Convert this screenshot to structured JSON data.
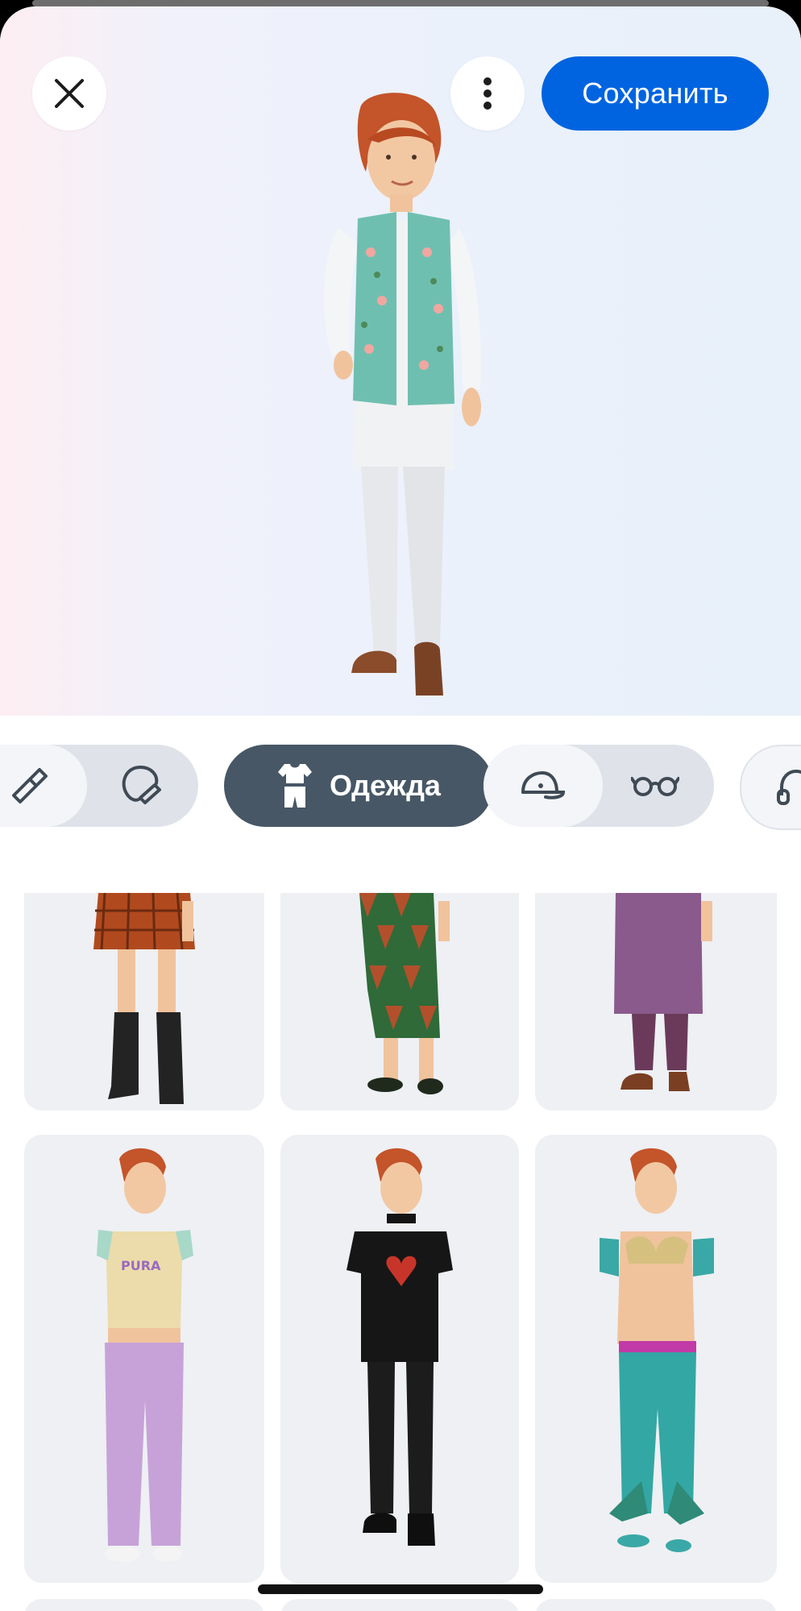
{
  "header": {
    "close_icon": "close-icon",
    "more_icon": "more-vertical-icon",
    "save_label": "Сохранить",
    "accent": "#0064e0"
  },
  "categories": {
    "items": [
      {
        "icon": "makeup-brush-icon"
      },
      {
        "icon": "hair-dryer-icon"
      },
      {
        "icon": "outfit-icon",
        "label": "Одежда",
        "active": true
      },
      {
        "icon": "cap-icon"
      },
      {
        "icon": "glasses-icon"
      },
      {
        "icon": "headphones-icon"
      }
    ],
    "active_label": "Одежда"
  },
  "outfits": [
    {
      "name": "plaid-skirt-boots"
    },
    {
      "name": "geometric-wrap-skirt"
    },
    {
      "name": "purple-tunic"
    },
    {
      "name": "crop-tee-purple-jeans"
    },
    {
      "name": "black-heart-dress"
    },
    {
      "name": "mermaid-outfit"
    }
  ]
}
